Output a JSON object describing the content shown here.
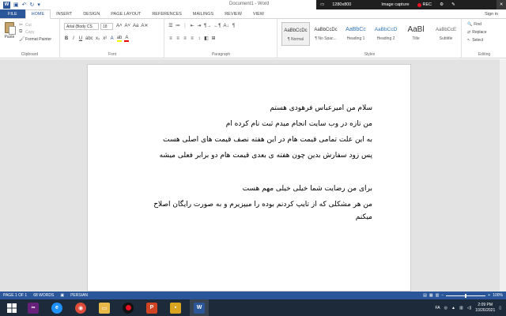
{
  "titlebar": {
    "doc_title": "Document1 - Word",
    "recorder": {
      "resolution": "1280x800",
      "mode": "Image capture",
      "rec_label": "REC"
    }
  },
  "tabs": [
    "FILE",
    "HOME",
    "INSERT",
    "DESIGN",
    "PAGE LAYOUT",
    "REFERENCES",
    "MAILINGS",
    "REVIEW",
    "VIEW"
  ],
  "active_tab": "HOME",
  "signin": "Sign in",
  "ribbon": {
    "clipboard": {
      "paste": "Paste",
      "cut": "Cut",
      "copy": "Copy",
      "format_painter": "Format Painter",
      "label": "Clipboard"
    },
    "font": {
      "name": "Arial (Body CS",
      "size": "18",
      "label": "Font"
    },
    "paragraph": {
      "label": "Paragraph"
    },
    "styles": {
      "label": "Styles",
      "items": [
        {
          "preview": "AaBbCcDc",
          "name": "¶ Normal"
        },
        {
          "preview": "AaBbCcDc",
          "name": "¶ No Spac..."
        },
        {
          "preview": "AaBbCc",
          "name": "Heading 1"
        },
        {
          "preview": "AaBbCcD",
          "name": "Heading 2"
        },
        {
          "preview": "AaBl",
          "name": "Title"
        },
        {
          "preview": "AaBbCcE",
          "name": "Subtitle"
        }
      ]
    },
    "editing": {
      "find": "Find",
      "replace": "Replace",
      "select": "Select",
      "label": "Editing"
    }
  },
  "document": {
    "lines": [
      "سلام من امیرعباس فرهودی هستم",
      "من تازه در وب سایت انجام میدم ثبت نام کرده ام",
      "به این علت تمامی قیمت هام در این هفته نصف قیمت های اصلی هست",
      "پس زود سفارش بدین چون هفته ی بعدی قیمت هام دو برابر فعلی میشه",
      "برای من رضایت شما خیلی خیلی مهم هست",
      "من هر مشکلی که از تایپ کردنم بوده را میپزیرم و به صورت رایگان اصلاح",
      "میکنم"
    ]
  },
  "statusbar": {
    "page": "PAGE 1 OF 1",
    "words": "68 WORDS",
    "language": "PERSIAN",
    "zoom": "100%"
  },
  "taskbar": {
    "lang": "FA",
    "time": "2:09 PM",
    "date": "10/26/2021"
  }
}
